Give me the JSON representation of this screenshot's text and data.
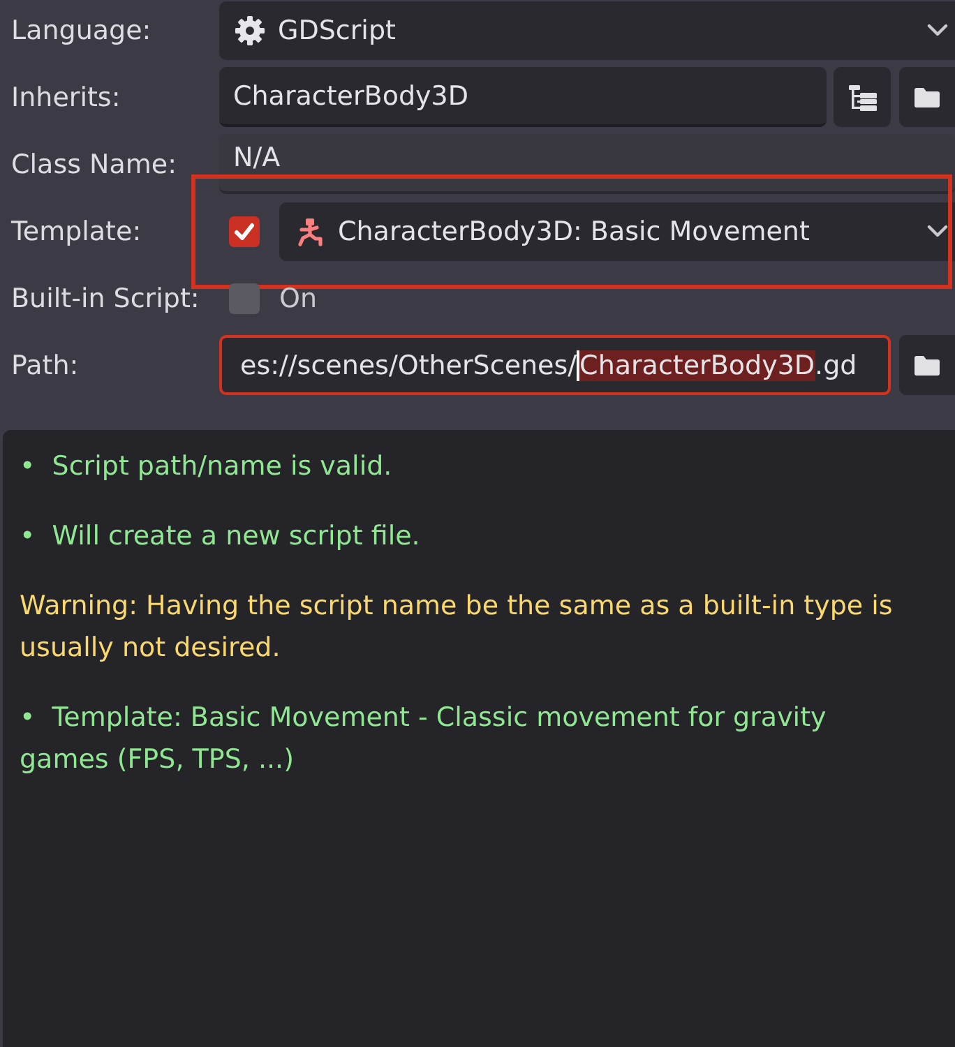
{
  "rows": [
    {
      "kind": "language",
      "label": "Language:",
      "value": "GDScript",
      "highlighted": false
    },
    {
      "kind": "inherits",
      "label": "Inherits:",
      "value": "CharacterBody3D",
      "highlighted": false
    },
    {
      "kind": "class_name",
      "label": "Class Name:",
      "value": "N/A",
      "editable": false,
      "highlighted": false
    },
    {
      "kind": "template",
      "label": "Template:",
      "checked": true,
      "value": "CharacterBody3D: Basic Movement",
      "highlighted": true
    },
    {
      "kind": "builtin",
      "label": "Built-in Script:",
      "checked": false,
      "text": "On",
      "highlighted": false
    },
    {
      "kind": "path",
      "label": "Path:",
      "value_before": "es://scenes/OtherScenes/",
      "selection": "CharacterBody3D",
      "value_after": ".gd",
      "highlighted": true
    }
  ],
  "messages": [
    {
      "kind": "info",
      "text": "•  Script path/name is valid."
    },
    {
      "kind": "info",
      "text": "•  Will create a new script file."
    },
    {
      "kind": "warning",
      "text": "Warning: Having the script name be the same as a built-in type is usually not desired."
    },
    {
      "kind": "info",
      "text": "•  Template: Basic Movement - Classic movement for gravity games (FPS, TPS, ...)"
    }
  ]
}
